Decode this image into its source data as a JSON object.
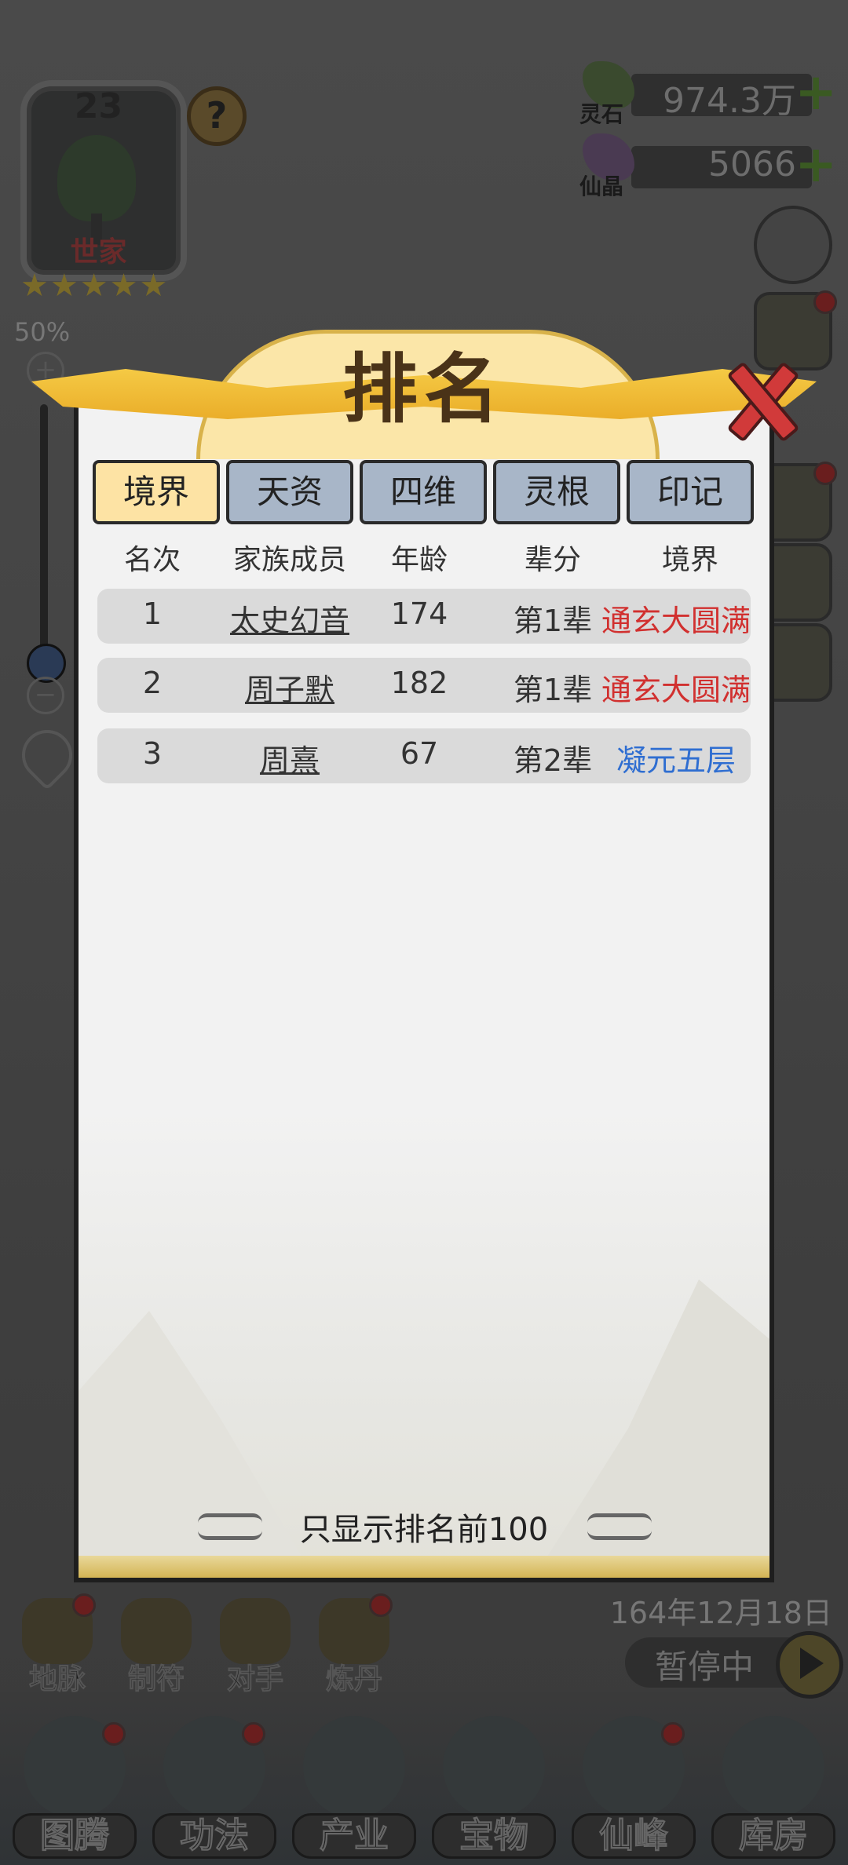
{
  "profile": {
    "level": "23",
    "clan_type": "世家",
    "stars": 5
  },
  "zoom": {
    "percent": "50%",
    "plus": "+",
    "minus": "−",
    "level": 0.2
  },
  "currencies": [
    {
      "label": "灵石",
      "value": "974.3万",
      "color": "#3a4a2e"
    },
    {
      "label": "仙晶",
      "value": "5066",
      "color": "#4a3a52"
    }
  ],
  "modal": {
    "title": "排名",
    "tabs": [
      "境界",
      "天资",
      "四维",
      "灵根",
      "印记"
    ],
    "active_tab": 0,
    "headers": [
      "名次",
      "家族成员",
      "年龄",
      "辈分",
      "境界"
    ],
    "rows": [
      {
        "rank": "1",
        "name": "太史幻音",
        "age": "174",
        "gen": "第1辈",
        "realm": "通玄大圆满",
        "realm_color": "red"
      },
      {
        "rank": "2",
        "name": "周子默",
        "age": "182",
        "gen": "第1辈",
        "realm": "通玄大圆满",
        "realm_color": "red"
      },
      {
        "rank": "3",
        "name": "周熹",
        "age": "67",
        "gen": "第2辈",
        "realm": "凝元五层",
        "realm_color": "blue"
      }
    ],
    "footnote": "只显示排名前100"
  },
  "date": "164年12月18日",
  "pause_label": "暂停中",
  "small_actions": [
    "地脉",
    "制符",
    "对手",
    "炼丹"
  ],
  "main_actions": [
    "图腾",
    "功法",
    "产业",
    "宝物",
    "仙峰",
    "库房"
  ],
  "colors": {
    "active_tab": "#fde3a4",
    "tab": "#a8b6c8",
    "realm_red": "#d1302f",
    "realm_blue": "#2f6ed1"
  }
}
